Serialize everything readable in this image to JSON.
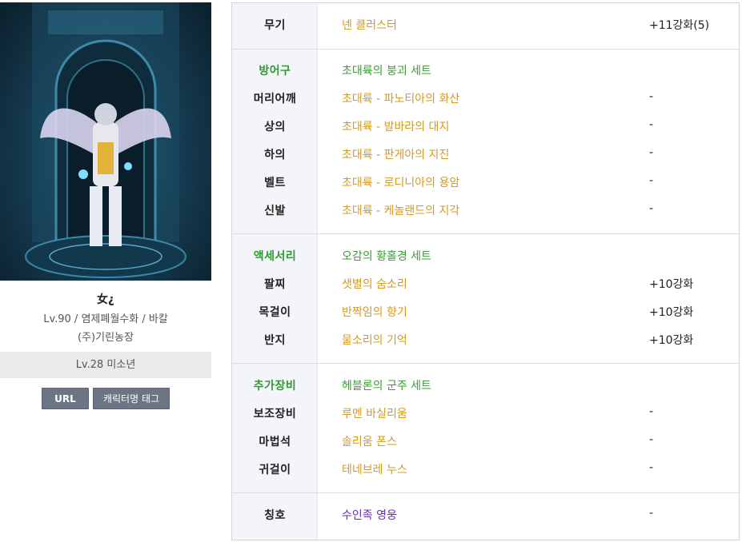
{
  "character": {
    "name": "女¿",
    "info": "Lv.90 / 염제폐월수화 / 바칼",
    "guild": "(주)기린농장",
    "adventure": "Lv.28 미소년"
  },
  "buttons": {
    "url_label": "URL",
    "tag_label": "캐릭터명 태그"
  },
  "equipment": {
    "weapon": {
      "label": "무기",
      "item": "넨 클러스터",
      "enhance": "+11강화(5)"
    },
    "armor": {
      "group": "방어구",
      "set": "초대륙의 붕괴 세트",
      "items": [
        {
          "label": "머리어깨",
          "item": "초대륙 - 파노티아의 화산",
          "enhance": "-"
        },
        {
          "label": "상의",
          "item": "초대륙 - 발바라의 대지",
          "enhance": "-"
        },
        {
          "label": "하의",
          "item": "초대륙 - 판게아의 지진",
          "enhance": "-"
        },
        {
          "label": "벨트",
          "item": "초대륙 - 로디니아의 용암",
          "enhance": "-"
        },
        {
          "label": "신발",
          "item": "초대륙 - 케놀랜드의 지각",
          "enhance": "-"
        }
      ]
    },
    "accessory": {
      "group": "액세서리",
      "set": "오감의 황홀경 세트",
      "items": [
        {
          "label": "팔찌",
          "item": "샛별의 숨소리",
          "enhance": "+10강화"
        },
        {
          "label": "목걸이",
          "item": "반짝임의 향기",
          "enhance": "+10강화"
        },
        {
          "label": "반지",
          "item": "물소리의 기억",
          "enhance": "+10강화"
        }
      ]
    },
    "extra": {
      "group": "추가장비",
      "set": "헤블론의 군주 세트",
      "items": [
        {
          "label": "보조장비",
          "item": "루멘 바실리움",
          "enhance": "-"
        },
        {
          "label": "마법석",
          "item": "솔리움 폰스",
          "enhance": "-"
        },
        {
          "label": "귀걸이",
          "item": "테네브레 누스",
          "enhance": "-"
        }
      ]
    },
    "title": {
      "label": "칭호",
      "item": "수인족 영웅",
      "enhance": "-"
    }
  },
  "colors": {
    "set_green": "#3b9b35",
    "item_gold": "#d29b1f",
    "title_purple": "#6b2bb0",
    "button_gray": "#6c7583"
  }
}
